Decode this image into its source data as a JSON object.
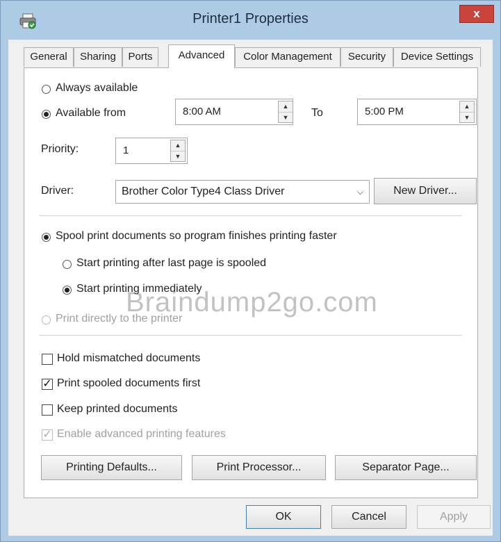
{
  "window": {
    "title": "Printer1 Properties",
    "close_label": "x"
  },
  "tabs": [
    {
      "label": "General",
      "active": false
    },
    {
      "label": "Sharing",
      "active": false
    },
    {
      "label": "Ports",
      "active": false
    },
    {
      "label": "Advanced",
      "active": true
    },
    {
      "label": "Color Management",
      "active": false
    },
    {
      "label": "Security",
      "active": false
    },
    {
      "label": "Device Settings",
      "active": false
    }
  ],
  "availability": {
    "always_label": "Always available",
    "from_label": "Available from",
    "from_value": "8:00 AM",
    "to_label": "To",
    "to_value": "5:00 PM"
  },
  "priority": {
    "label": "Priority:",
    "value": "1"
  },
  "driver": {
    "label": "Driver:",
    "value": "Brother Color Type4 Class Driver",
    "new_driver_label": "New Driver..."
  },
  "spool": {
    "spool_label": "Spool print documents so program finishes printing faster",
    "after_last_page_label": "Start printing after last page is spooled",
    "immediately_label": "Start printing immediately",
    "direct_label": "Print directly to the printer"
  },
  "options": {
    "hold_mismatched_label": "Hold mismatched documents",
    "spooled_first_label": "Print spooled documents first",
    "keep_printed_label": "Keep printed documents",
    "advanced_features_label": "Enable advanced printing features",
    "check_glyph": "✓"
  },
  "buttons": {
    "printing_defaults": "Printing Defaults...",
    "print_processor": "Print Processor...",
    "separator_page": "Separator Page...",
    "ok": "OK",
    "cancel": "Cancel",
    "apply": "Apply"
  },
  "watermark": "Braindump2go.com",
  "colors": {
    "titlebar": "#aecbe5",
    "close": "#c9443a",
    "panel": "#ffffff"
  }
}
